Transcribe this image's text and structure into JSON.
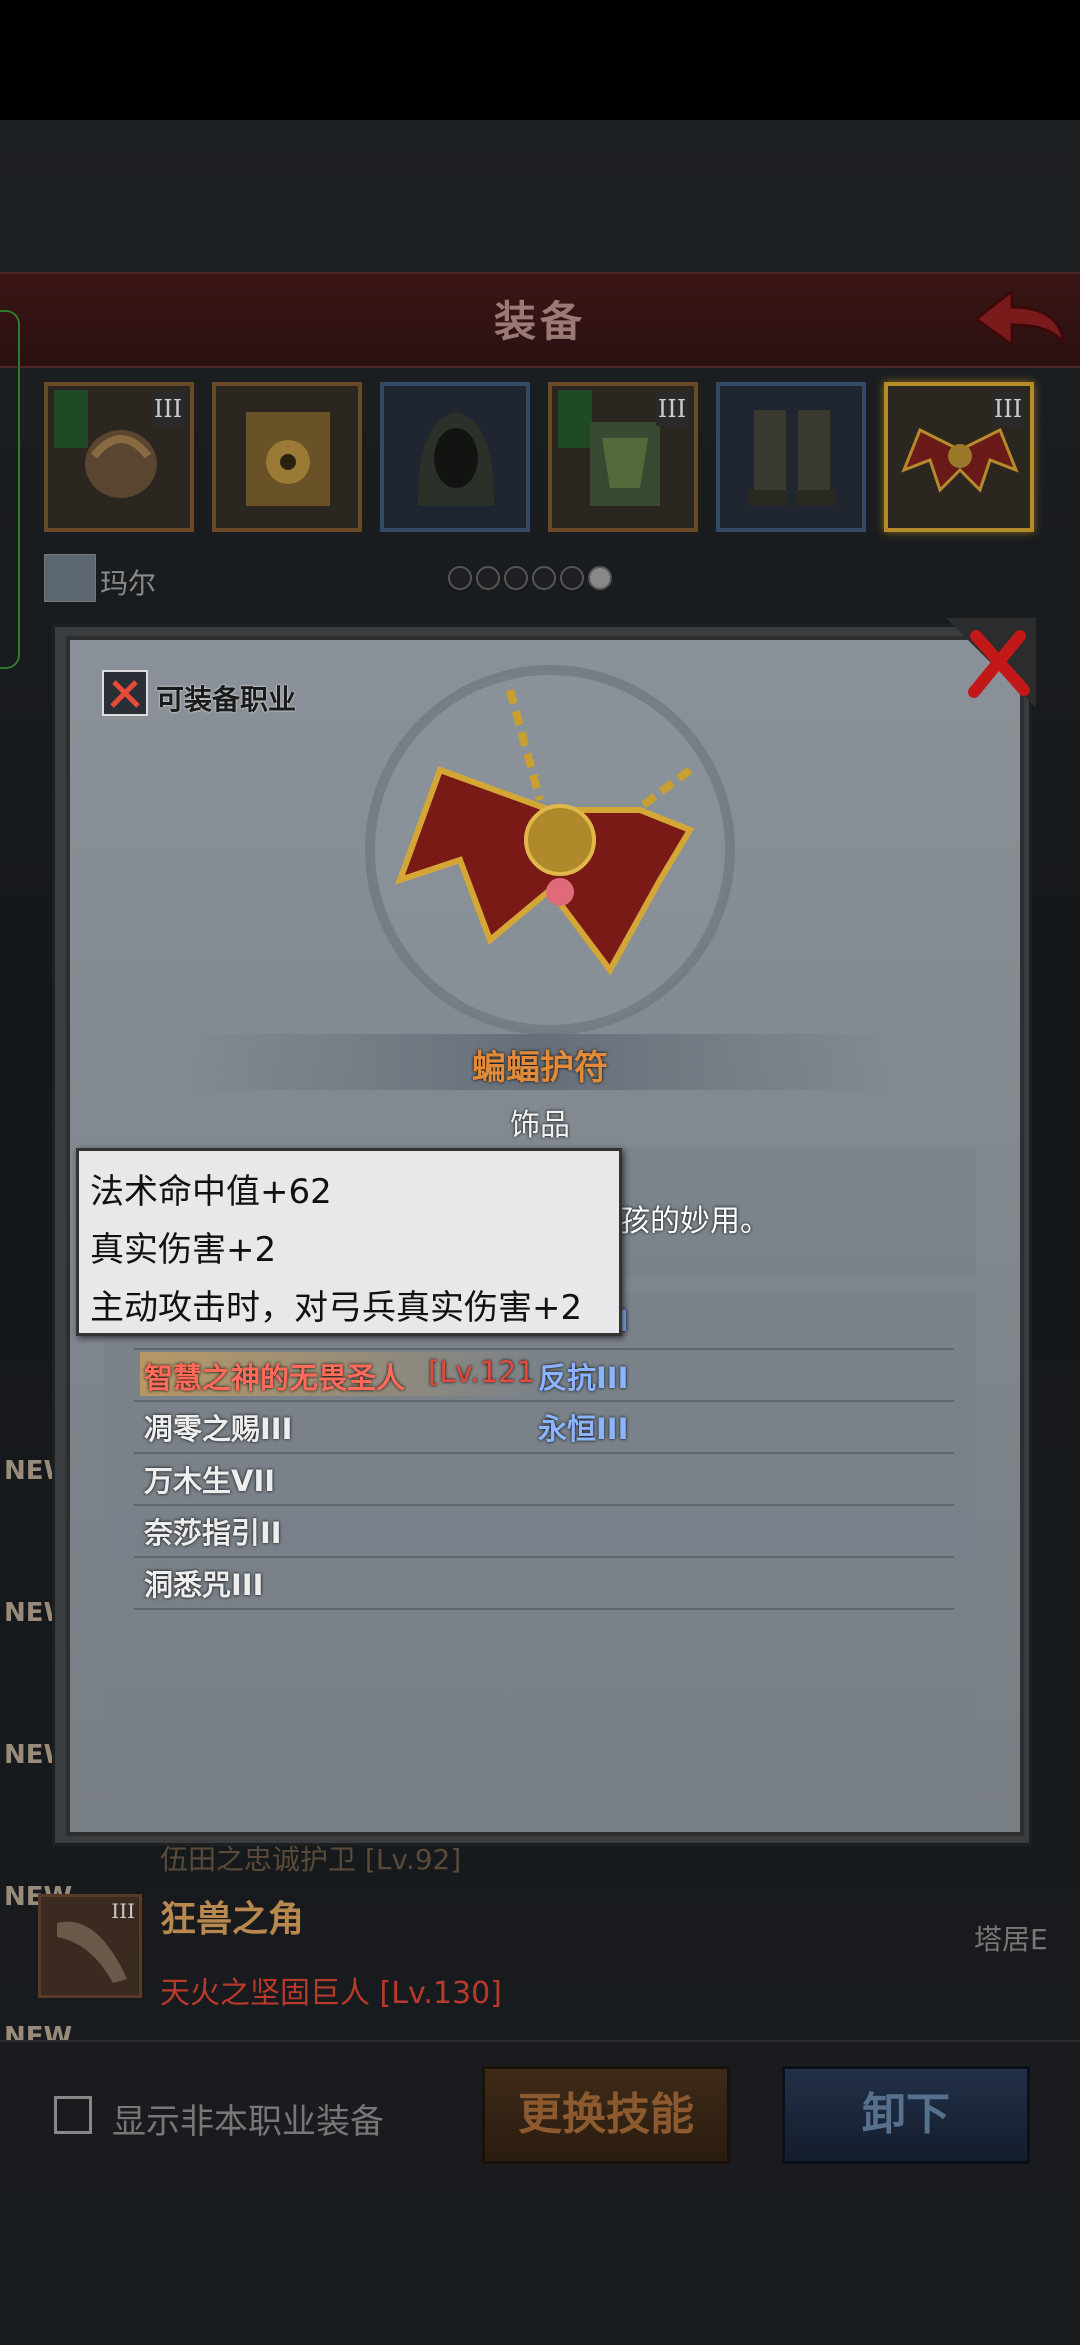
{
  "header": {
    "title": "装备"
  },
  "character": {
    "name": "玛尔"
  },
  "page_dots": {
    "count": 6,
    "active": 5
  },
  "equip_slots": [
    {
      "tier": "III",
      "icon": "dragon-helm-icon",
      "frame": "bronze"
    },
    {
      "tier": "",
      "icon": "golden-armor-icon",
      "frame": "bronze"
    },
    {
      "tier": "",
      "icon": "hood-icon",
      "frame": "blue"
    },
    {
      "tier": "III",
      "icon": "leaf-armor-icon",
      "frame": "bronze"
    },
    {
      "tier": "",
      "icon": "boots-icon",
      "frame": "blue"
    },
    {
      "tier": "III",
      "icon": "bat-amulet-icon",
      "frame": "selected"
    }
  ],
  "modal": {
    "class_tag": "可装备职业",
    "item_name": "蝙蝠护符",
    "item_type": "饰品",
    "desc_fragment": "果小孩的妙用。",
    "skills_left": [
      {
        "text": "智慧之神的无畏圣人",
        "level": "[Lv.121",
        "highlight": true
      },
      {
        "text": "凋零之赐III"
      },
      {
        "text": "万木生VII"
      },
      {
        "text": "奈莎指引II"
      },
      {
        "text": "洞悉咒III"
      }
    ],
    "skills_right": [
      {
        "text": "I"
      },
      {
        "text": "反抗III"
      },
      {
        "text": "永恒III"
      }
    ]
  },
  "tooltip": {
    "lines": [
      "法术命中值+62",
      "真实伤害+2",
      "主动攻击时，对弓兵真实伤害+2"
    ]
  },
  "list_item": {
    "new_label": "NEW",
    "tier": "III",
    "name": "狂兽之角",
    "hero": "天火之坚固巨人 [Lv.130]",
    "right_tag": "塔居E",
    "prev_hero": "伍田之忠诚护卫 [Lv.92]"
  },
  "side_new_labels": [
    "NEW",
    "NEW",
    "NEW",
    "NEW"
  ],
  "bottom": {
    "checkbox_label": "显示非本职业装备",
    "swap_button": "更换技能",
    "unequip_button": "卸下"
  },
  "colors": {
    "accent_orange": "#e08a3a",
    "skill_blue": "#8ab4ff",
    "highlight_red": "#ff6a5a"
  }
}
